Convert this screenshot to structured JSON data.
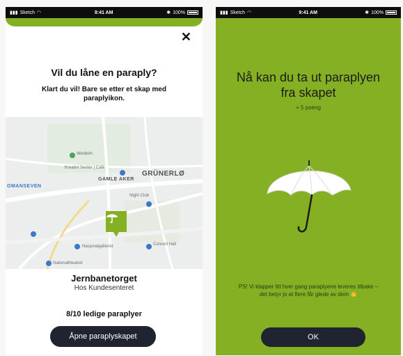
{
  "status": {
    "carrier": "Sketch",
    "time": "9:41 AM",
    "battery": "100%"
  },
  "left": {
    "close_icon": "close-icon",
    "title": "Vil du låne en paraply?",
    "subtitle": "Klart du vil! Bare se etter et skap med paraplyikon.",
    "map": {
      "areas": [
        "GAMLE AKER",
        "GRÜNERLØ"
      ],
      "left_area": "OMANSEVEN",
      "labels": [
        "Westkim",
        "Kreativt Senter | Café",
        "Night Club",
        "Nasjonalgalleriet",
        "Concert Hall",
        "Nationaltheatret"
      ]
    },
    "place_name": "Jernbanetorget",
    "place_sub": "Hos Kundesenteret",
    "availability": "8/10 ledige paraplyer",
    "open_button": "Åpne paraplyskapet"
  },
  "right": {
    "title_line1": "Nå kan du ta ut paraplyen",
    "title_line2": "fra skapet",
    "points": "+ 5 poeng",
    "ps": "PS! Vi klapper litt hver gang paraplyene leveres tilbake – det betyr jo at flere får glede av dem 👏",
    "ok": "OK"
  },
  "colors": {
    "green": "#86b024",
    "dark_button": "#1f2430"
  }
}
